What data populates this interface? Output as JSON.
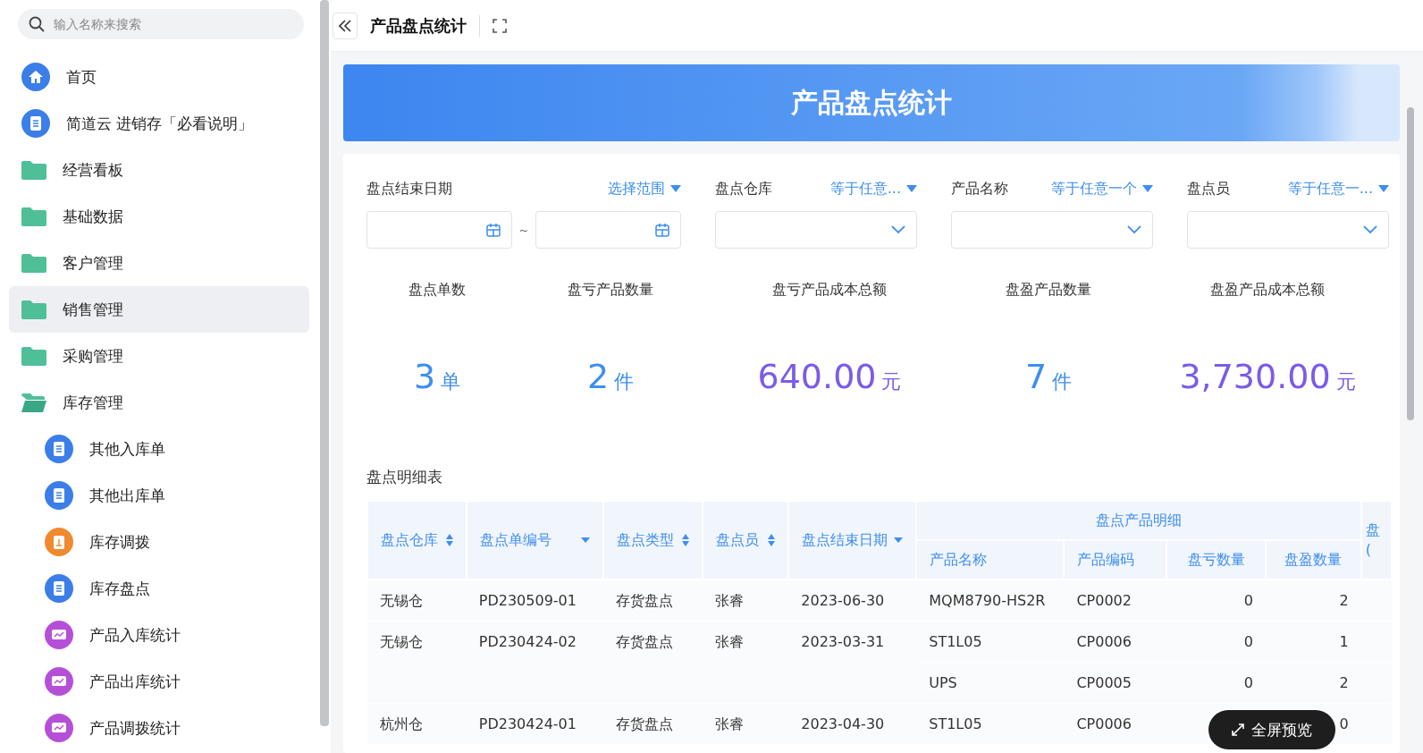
{
  "sidebar": {
    "search": {
      "placeholder": "输入名称来搜索"
    },
    "items": [
      {
        "label": "首页",
        "kind": "home",
        "selected": false
      },
      {
        "label": "简道云 进销存「必看说明」",
        "kind": "doc",
        "selected": false
      },
      {
        "label": "经营看板",
        "kind": "folder",
        "selected": false
      },
      {
        "label": "基础数据",
        "kind": "folder",
        "selected": false
      },
      {
        "label": "客户管理",
        "kind": "folder",
        "selected": false
      },
      {
        "label": "销售管理",
        "kind": "folder",
        "selected": true
      },
      {
        "label": "采购管理",
        "kind": "folder",
        "selected": false
      },
      {
        "label": "库存管理",
        "kind": "folder",
        "selected": false,
        "expanded": true,
        "children": [
          {
            "label": "其他入库单",
            "kind": "doc",
            "selected": false
          },
          {
            "label": "其他出库单",
            "kind": "doc",
            "selected": false
          },
          {
            "label": "库存调拨",
            "kind": "transfer",
            "selected": false
          },
          {
            "label": "库存盘点",
            "kind": "doc",
            "selected": false
          },
          {
            "label": "产品入库统计",
            "kind": "chart",
            "selected": false
          },
          {
            "label": "产品出库统计",
            "kind": "chart",
            "selected": false
          },
          {
            "label": "产品调拨统计",
            "kind": "chart",
            "selected": false
          }
        ]
      }
    ]
  },
  "topbar": {
    "title": "产品盘点统计"
  },
  "banner": {
    "title": "产品盘点统计"
  },
  "filters": [
    {
      "kind": "date-range",
      "label": "盘点结束日期",
      "operator": "选择范围",
      "separator": "~"
    },
    {
      "kind": "select",
      "label": "盘点仓库",
      "operator": "等于任意..."
    },
    {
      "kind": "select",
      "label": "产品名称",
      "operator": "等于任意一个"
    },
    {
      "kind": "select",
      "label": "盘点员",
      "operator": "等于任意一..."
    }
  ],
  "stats": [
    {
      "label": "盘点单数",
      "value": "3",
      "unit": "单",
      "color": "#3d8ef0"
    },
    {
      "label": "盘亏产品数量",
      "value": "2",
      "unit": "件",
      "color": "#3d8ef0"
    },
    {
      "label": "盘亏产品成本总额",
      "value": "640.00",
      "unit": "元",
      "color": "#7b5ce6"
    },
    {
      "label": "盘盈产品数量",
      "value": "7",
      "unit": "件",
      "color": "#3d8ef0"
    },
    {
      "label": "盘盈产品成本总额",
      "value": "3,730.00",
      "unit": "元",
      "color": "#7b5ce6"
    }
  ],
  "table": {
    "title": "盘点明细表",
    "columns": [
      {
        "label": "盘点仓库",
        "kind": "sort"
      },
      {
        "label": "盘点单编号",
        "kind": "filter"
      },
      {
        "label": "盘点类型",
        "kind": "sort"
      },
      {
        "label": "盘点员",
        "kind": "sort"
      },
      {
        "label": "盘点结束日期",
        "kind": "filter"
      }
    ],
    "group": {
      "label": "盘点产品明细",
      "columns": [
        "产品名称",
        "产品编码",
        "盘亏数量",
        "盘盈数量"
      ]
    },
    "column_10": [
      "盘",
      "("
    ],
    "rows": [
      {
        "warehouse": "无锡仓",
        "number": "PD230509-01",
        "type": "存货盘点",
        "checker": "张睿",
        "date": "2023-06-30",
        "products": [
          {
            "name": "MQM8790-HS2R",
            "code": "CP0002",
            "loss": "0",
            "gain": "2"
          }
        ]
      },
      {
        "warehouse": "无锡仓",
        "number": "PD230424-02",
        "type": "存货盘点",
        "checker": "张睿",
        "date": "2023-03-31",
        "products": [
          {
            "name": "ST1L05",
            "code": "CP0006",
            "loss": "0",
            "gain": "1"
          },
          {
            "name": "UPS",
            "code": "CP0005",
            "loss": "0",
            "gain": "2"
          }
        ]
      },
      {
        "warehouse": "杭州仓",
        "number": "PD230424-01",
        "type": "存货盘点",
        "checker": "张睿",
        "date": "2023-04-30",
        "products": [
          {
            "name": "ST1L05",
            "code": "CP0006",
            "gain": "0"
          }
        ]
      }
    ]
  },
  "preview_button": {
    "label": "全屏预览"
  }
}
